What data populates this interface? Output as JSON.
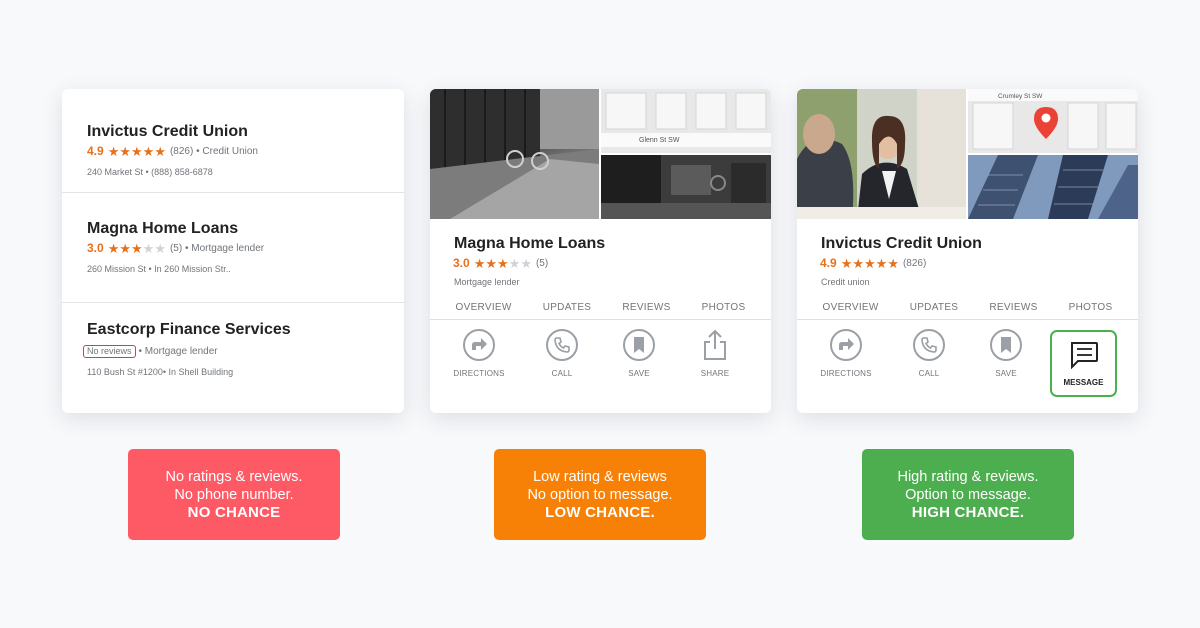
{
  "list_card": {
    "items": [
      {
        "name": "Invictus Credit Union",
        "rating": "4.9",
        "stars": 5,
        "reviews": "(826)",
        "category": "• Credit Union",
        "address": "240 Market St • (888) 858-6878"
      },
      {
        "name": "Magna Home Loans",
        "rating": "3.0",
        "stars": 3,
        "reviews": "(5)",
        "category": "• Mortgage lender",
        "address": "260 Mission St • In 260 Mission Str.."
      },
      {
        "name": "Eastcorp Finance Services",
        "no_reviews": "No reviews",
        "category": "• Mortgage lender",
        "address": "110 Bush St #1200• In Shell Building"
      }
    ]
  },
  "detail_magna": {
    "name": "Magna Home Loans",
    "rating": "3.0",
    "stars": 3,
    "reviews": "(5)",
    "category": "Mortgage lender",
    "map_street": "Glenn St SW",
    "tabs": [
      "OVERVIEW",
      "UPDATES",
      "REVIEWS",
      "PHOTOS"
    ],
    "actions": [
      "DIRECTIONS",
      "CALL",
      "SAVE",
      "SHARE"
    ]
  },
  "detail_invictus": {
    "name": "Invictus Credit Union",
    "rating": "4.9",
    "stars": 5,
    "reviews": "(826)",
    "category": "Credit union",
    "map_street": "Crumley St SW",
    "tabs": [
      "OVERVIEW",
      "UPDATES",
      "REVIEWS",
      "PHOTOS"
    ],
    "actions": [
      "DIRECTIONS",
      "CALL",
      "SAVE"
    ],
    "message_label": "MESSAGE"
  },
  "verdicts": {
    "red": {
      "line1": "No ratings & reviews.",
      "line2": "No phone number.",
      "line3": "NO CHANCE"
    },
    "orange": {
      "line1": "Low rating & reviews",
      "line2": "No option to message.",
      "line3": "LOW CHANCE."
    },
    "green": {
      "line1": "High rating & reviews.",
      "line2": "Option to message.",
      "line3": "HIGH CHANCE."
    }
  },
  "colors": {
    "star": "#e7711b",
    "red": "#fe5a65",
    "orange": "#f78107",
    "green": "#4cae4f",
    "map_pin": "#ea4335"
  },
  "icons": [
    "directions-icon",
    "call-icon",
    "save-icon",
    "share-icon",
    "message-icon",
    "map-pin-icon",
    "star-icon"
  ]
}
